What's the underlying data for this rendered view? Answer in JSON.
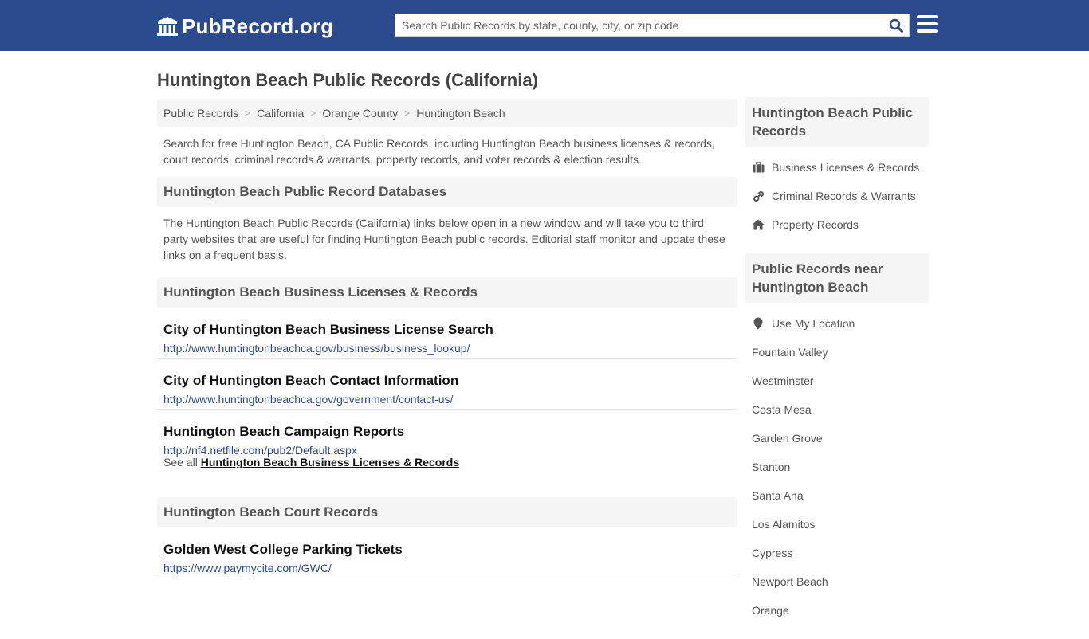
{
  "header": {
    "logo_text": "PubRecord.org",
    "search_placeholder": "Search Public Records by state, county, city, or zip code",
    "brand_color": "#2c4a8e"
  },
  "page_title": "Huntington Beach Public Records (California)",
  "breadcrumb": [
    "Public Records",
    "California",
    "Orange County",
    "Huntington Beach"
  ],
  "intro": "Search for free Huntington Beach, CA Public Records, including Huntington Beach business licenses & records, court records, criminal records & warrants, property records, and voter records & election results.",
  "databases": {
    "heading": "Huntington Beach Public Record Databases",
    "description": "The Huntington Beach Public Records (California) links below open in a new window and will take you to third party websites that are useful for finding Huntington Beach public records. Editorial staff monitor and update these links on a frequent basis."
  },
  "business": {
    "heading": "Huntington Beach Business Licenses & Records",
    "links": [
      {
        "title": "City of Huntington Beach Business License Search",
        "url": "http://www.huntingtonbeachca.gov/business/business_lookup/"
      },
      {
        "title": "City of Huntington Beach Contact Information",
        "url": "http://www.huntingtonbeachca.gov/government/contact-us/"
      },
      {
        "title": "Huntington Beach Campaign Reports",
        "url": "http://nf4.netfile.com/pub2/Default.aspx"
      }
    ],
    "see_all_prefix": "See all",
    "see_all_link": "Huntington Beach Business Licenses & Records"
  },
  "court": {
    "heading": "Huntington Beach Court Records",
    "links": [
      {
        "title": "Golden West College Parking Tickets",
        "url": "https://www.paymycite.com/GWC/"
      }
    ]
  },
  "sidebar": {
    "records_heading": "Huntington Beach Public Records",
    "records_items": [
      {
        "label": "Business Licenses & Records",
        "icon": "briefcase-icon"
      },
      {
        "label": "Criminal Records & Warrants",
        "icon": "link-icon"
      },
      {
        "label": "Property Records",
        "icon": "home-icon"
      }
    ],
    "nearby_heading": "Public Records near Huntington Beach",
    "use_location": "Use My Location",
    "nearby": [
      "Fountain Valley",
      "Westminster",
      "Costa Mesa",
      "Garden Grove",
      "Stanton",
      "Santa Ana",
      "Los Alamitos",
      "Cypress",
      "Newport Beach",
      "Orange"
    ]
  }
}
